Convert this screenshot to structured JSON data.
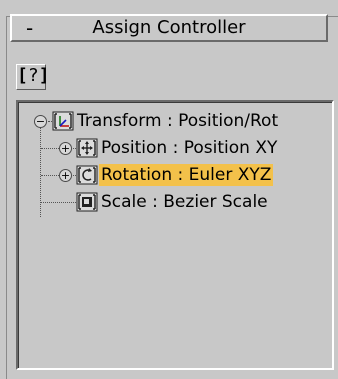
{
  "rollout": {
    "collapse_symbol": "-",
    "title": "Assign Controller"
  },
  "help_button": {
    "label": "?"
  },
  "tree": {
    "items": [
      {
        "label": "Transform : Position/Rot",
        "icon": "transform-controller-icon",
        "expander": "minus",
        "selected": false
      },
      {
        "label": "Position : Position XY",
        "icon": "position-controller-icon",
        "expander": "plus",
        "selected": false
      },
      {
        "label": "Rotation : Euler XYZ",
        "icon": "rotation-controller-icon",
        "expander": "plus",
        "selected": true
      },
      {
        "label": "Scale : Bezier Scale",
        "icon": "scale-controller-icon",
        "expander": "none",
        "selected": false
      }
    ]
  },
  "colors": {
    "panel_bg": "#c8c8c8",
    "selection": "#f3c14a"
  }
}
